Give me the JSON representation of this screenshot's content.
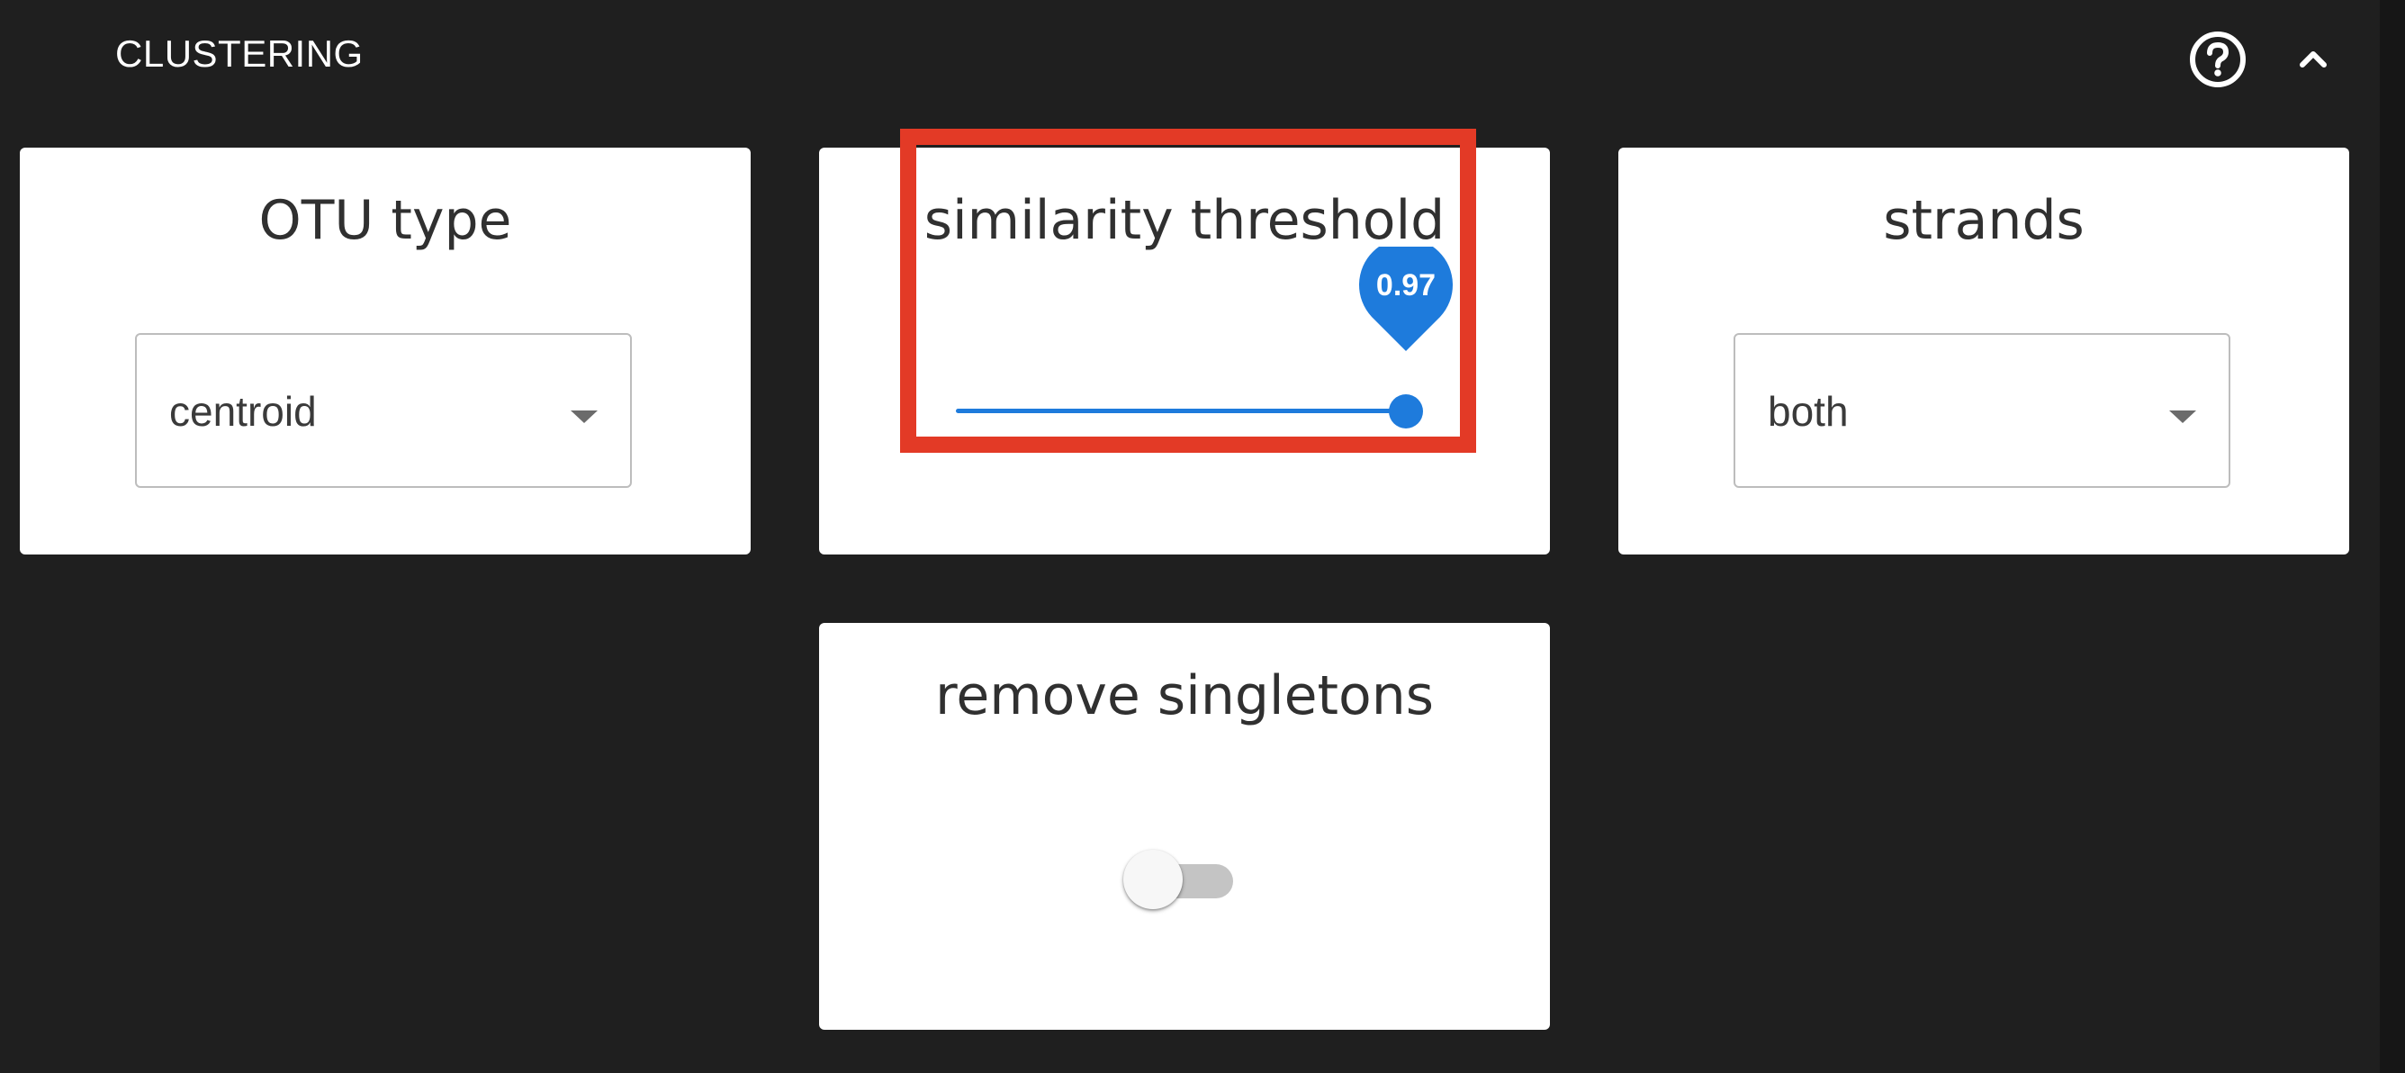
{
  "section": {
    "title": "CLUSTERING",
    "help_icon": "help-circle-icon",
    "collapse_icon": "chevron-up-icon"
  },
  "cards": {
    "otu_type": {
      "title": "OTU type",
      "value": "centroid"
    },
    "similarity_threshold": {
      "title": "similarity threshold",
      "value_label": "0.97",
      "value": 0.97,
      "min": 0,
      "max": 0.97,
      "highlighted": true
    },
    "strands": {
      "title": "strands",
      "value": "both"
    },
    "remove_singletons": {
      "title": "remove singletons",
      "enabled": false
    }
  },
  "colors": {
    "background": "#1f1f1f",
    "card": "#ffffff",
    "accent": "#1e7bdc",
    "highlight": "#e33a26",
    "toggle_off_track": "#c4c4c4"
  }
}
